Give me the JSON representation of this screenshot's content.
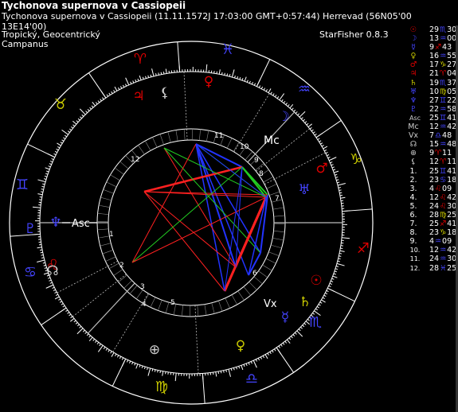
{
  "header": {
    "title": "Tychonova supernova v Cassiopeii",
    "subtitle": "Tychonova supernova v Cassiopeii (11.11.1572J 17:03:00 GMT+0:57:44) Herrevad (56N05'00 13E14'00)",
    "zodiac_line": "Tropický, Geocentrický",
    "house_line": "Campanus",
    "app_version": "StarFisher 0.8.3"
  },
  "colors": {
    "fire": "#dd0000",
    "earth": "#cccc00",
    "air": "#4444ff",
    "water": "#aaaaaa",
    "red_aspect": "#ff2020",
    "green_aspect": "#22cc22",
    "blue_aspect": "#2233ff"
  },
  "wheel": {
    "asc_label": "Asc",
    "mc_label": "Mc",
    "vx_label": "Vx",
    "house_numbers": [
      "1",
      "2",
      "3",
      "4",
      "5",
      "6",
      "7",
      "8",
      "9",
      "10",
      "11",
      "12"
    ],
    "signs": [
      {
        "name": "aries-icon",
        "glyph": "♈",
        "color": "#dd0000"
      },
      {
        "name": "pisces-icon",
        "glyph": "♓",
        "color": "#4444ff"
      },
      {
        "name": "aquarius-icon",
        "glyph": "♒",
        "color": "#4444ff"
      },
      {
        "name": "capricorn-icon",
        "glyph": "♑",
        "color": "#cccc00"
      },
      {
        "name": "sagittarius-icon",
        "glyph": "♐",
        "color": "#dd0000"
      },
      {
        "name": "scorpio-icon",
        "glyph": "♏",
        "color": "#4444ff"
      },
      {
        "name": "libra-icon",
        "glyph": "♎",
        "color": "#4444ff"
      },
      {
        "name": "virgo-icon",
        "glyph": "♍",
        "color": "#cccc00"
      },
      {
        "name": "leo-icon",
        "glyph": "♌",
        "color": "#dd0000"
      },
      {
        "name": "cancer-icon",
        "glyph": "♋",
        "color": "#4444ff"
      },
      {
        "name": "gemini-icon",
        "glyph": "♊",
        "color": "#4444ff"
      },
      {
        "name": "taurus-icon",
        "glyph": "♉",
        "color": "#cccc00"
      }
    ],
    "planets": [
      {
        "name": "jupiter-icon",
        "glyph": "♃",
        "color": "#dd0000"
      },
      {
        "name": "lilith-icon",
        "glyph": "⚸",
        "color": "#cccccc"
      },
      {
        "name": "venus-icon",
        "glyph": "♀",
        "color": "#dd0000"
      },
      {
        "name": "moon-icon",
        "glyph": "☽",
        "color": "#4444ff"
      },
      {
        "name": "mars-icon",
        "glyph": "♂",
        "color": "#dd0000"
      },
      {
        "name": "uranus-icon",
        "glyph": "♅",
        "color": "#4444ff"
      },
      {
        "name": "sun-icon",
        "glyph": "☉",
        "color": "#dd0000"
      },
      {
        "name": "saturn-icon",
        "glyph": "♄",
        "color": "#cccc00"
      },
      {
        "name": "mercury-icon",
        "glyph": "☿",
        "color": "#4444ff"
      },
      {
        "name": "venus-icon",
        "glyph": "♀",
        "color": "#cccc00"
      },
      {
        "name": "fortune-icon",
        "glyph": "⊕",
        "color": "#cccccc"
      },
      {
        "name": "neptune-icon",
        "glyph": "♆",
        "color": "#4444ff"
      },
      {
        "name": "pluto-icon",
        "glyph": "♇",
        "color": "#4444ff"
      },
      {
        "name": "node-icon",
        "glyph": "☊",
        "color": "#cccccc"
      }
    ]
  },
  "table": [
    {
      "glyph": "☉",
      "icon": "sun-icon",
      "color": "#dd0000",
      "deg": "29",
      "sign": "♏",
      "sign_color": "#4444ff",
      "min": "30"
    },
    {
      "glyph": "☽",
      "icon": "moon-icon",
      "color": "#4444ff",
      "deg": "13",
      "sign": "♒",
      "sign_color": "#4444ff",
      "min": "00"
    },
    {
      "glyph": "☿",
      "icon": "mercury-icon",
      "color": "#4444ff",
      "deg": "9",
      "sign": "♐",
      "sign_color": "#dd0000",
      "min": "43"
    },
    {
      "glyph": "♀",
      "icon": "venus-icon",
      "color": "#cccc00",
      "deg": "16",
      "sign": "♒",
      "sign_color": "#4444ff",
      "min": "55"
    },
    {
      "glyph": "♂",
      "icon": "mars-icon",
      "color": "#dd0000",
      "deg": "17",
      "sign": "♑",
      "sign_color": "#cccc00",
      "min": "27"
    },
    {
      "glyph": "♃",
      "icon": "jupiter-icon",
      "color": "#dd0000",
      "deg": "21",
      "sign": "♈",
      "sign_color": "#dd0000",
      "min": "04"
    },
    {
      "glyph": "♄",
      "icon": "saturn-icon",
      "color": "#cccc00",
      "deg": "19",
      "sign": "♏",
      "sign_color": "#4444ff",
      "min": "37"
    },
    {
      "glyph": "♅",
      "icon": "uranus-icon",
      "color": "#4444ff",
      "deg": "10",
      "sign": "♍",
      "sign_color": "#cccc00",
      "min": "05"
    },
    {
      "glyph": "♆",
      "icon": "neptune-icon",
      "color": "#4444ff",
      "deg": "27",
      "sign": "♊",
      "sign_color": "#4444ff",
      "min": "22"
    },
    {
      "glyph": "♇",
      "icon": "pluto-icon",
      "color": "#4444ff",
      "deg": "22",
      "sign": "♒",
      "sign_color": "#4444ff",
      "min": "58"
    },
    {
      "glyph": "Asc",
      "icon": "asc-label",
      "color": "#cccccc",
      "deg": "25",
      "sign": "♊",
      "sign_color": "#4444ff",
      "min": "41"
    },
    {
      "glyph": "Mc",
      "icon": "mc-label",
      "color": "#cccccc",
      "deg": "12",
      "sign": "♒",
      "sign_color": "#4444ff",
      "min": "42"
    },
    {
      "glyph": "Vx",
      "icon": "vx-label",
      "color": "#cccccc",
      "deg": "7",
      "sign": "♎",
      "sign_color": "#4444ff",
      "min": "48"
    },
    {
      "glyph": "☊",
      "icon": "node-icon",
      "color": "#cccccc",
      "deg": "15",
      "sign": "♒",
      "sign_color": "#4444ff",
      "min": "48"
    },
    {
      "glyph": "⊕",
      "icon": "fortune-icon",
      "color": "#cccccc",
      "deg": "9",
      "sign": "♈",
      "sign_color": "#dd0000",
      "min": "11"
    },
    {
      "glyph": "⚸",
      "icon": "lilith-icon",
      "color": "#cccccc",
      "deg": "12",
      "sign": "♈",
      "sign_color": "#dd0000",
      "min": "11"
    },
    {
      "glyph": "1.",
      "icon": "house-1",
      "color": "#ffffff",
      "deg": "25",
      "sign": "♊",
      "sign_color": "#4444ff",
      "min": "41"
    },
    {
      "glyph": "2.",
      "icon": "house-2",
      "color": "#ffffff",
      "deg": "23",
      "sign": "♋",
      "sign_color": "#4444ff",
      "min": "18"
    },
    {
      "glyph": "3.",
      "icon": "house-3",
      "color": "#ffffff",
      "deg": "4",
      "sign": "♌",
      "sign_color": "#dd0000",
      "min": "09"
    },
    {
      "glyph": "4.",
      "icon": "house-4",
      "color": "#ffffff",
      "deg": "12",
      "sign": "♌",
      "sign_color": "#dd0000",
      "min": "42"
    },
    {
      "glyph": "5.",
      "icon": "house-5",
      "color": "#ffffff",
      "deg": "24",
      "sign": "♌",
      "sign_color": "#dd0000",
      "min": "30"
    },
    {
      "glyph": "6.",
      "icon": "house-6",
      "color": "#ffffff",
      "deg": "28",
      "sign": "♍",
      "sign_color": "#cccc00",
      "min": "25"
    },
    {
      "glyph": "7.",
      "icon": "house-7",
      "color": "#ffffff",
      "deg": "25",
      "sign": "♐",
      "sign_color": "#dd0000",
      "min": "41"
    },
    {
      "glyph": "8.",
      "icon": "house-8",
      "color": "#ffffff",
      "deg": "23",
      "sign": "♑",
      "sign_color": "#cccc00",
      "min": "18"
    },
    {
      "glyph": "9.",
      "icon": "house-9",
      "color": "#ffffff",
      "deg": "4",
      "sign": "♒",
      "sign_color": "#4444ff",
      "min": "09"
    },
    {
      "glyph": "10.",
      "icon": "house-10",
      "color": "#ffffff",
      "deg": "12",
      "sign": "♒",
      "sign_color": "#4444ff",
      "min": "42"
    },
    {
      "glyph": "11.",
      "icon": "house-11",
      "color": "#ffffff",
      "deg": "24",
      "sign": "♒",
      "sign_color": "#4444ff",
      "min": "30"
    },
    {
      "glyph": "12.",
      "icon": "house-12",
      "color": "#ffffff",
      "deg": "28",
      "sign": "♓",
      "sign_color": "#4444ff",
      "min": "25"
    }
  ]
}
